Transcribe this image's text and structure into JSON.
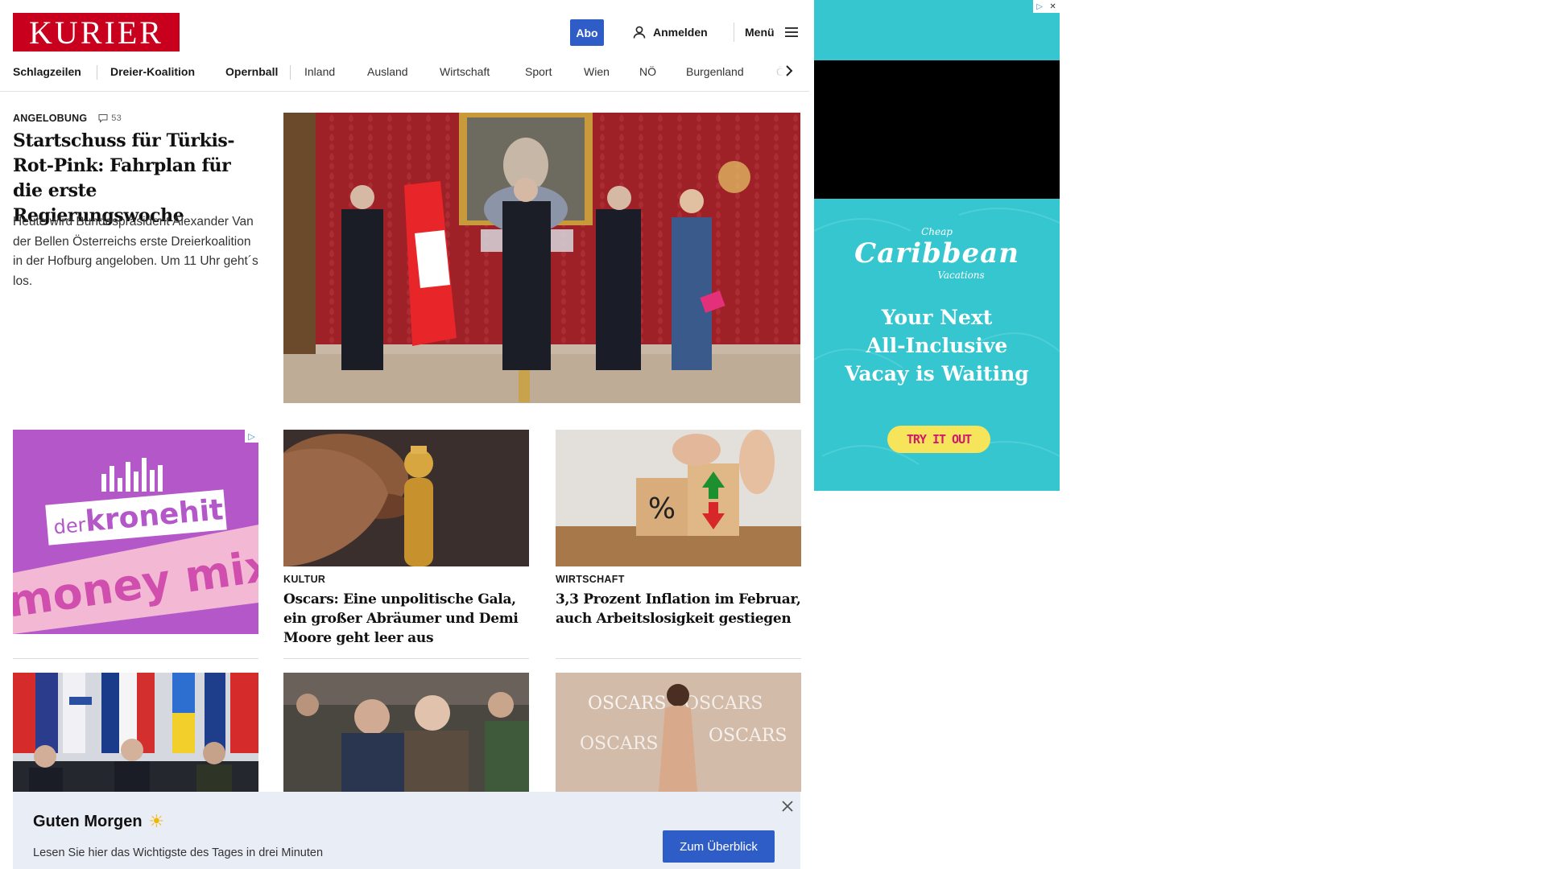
{
  "header": {
    "logo": "KURIER",
    "abo_label": "Abo",
    "login_label": "Anmelden",
    "menu_label": "Menü"
  },
  "nav": {
    "items": [
      "Schlagzeilen",
      "Dreier-Koalition",
      "Opernball",
      "Inland",
      "Ausland",
      "Wirtschaft",
      "Sport",
      "Wien",
      "NÖ",
      "Burgenland",
      "Ö"
    ]
  },
  "lead": {
    "kicker": "ANGELOBUNG",
    "comments": "53",
    "title": "Startschuss für Türkis-Rot-Pink: Fahrplan für die erste Regierungswoche",
    "teaser": "Heute wird Bundespräsident Alexander Van der Bellen Österreichs erste Dreierkoalition in der Hofburg angeloben. Um 11 Uhr geht´s los."
  },
  "ad_left": {
    "brand_prefix": "der",
    "brand": "kronehit",
    "tagline": "money mix"
  },
  "cards": [
    {
      "kicker": "KULTUR",
      "title": "Oscars: Eine unpolitische Gala, ein großer Abräumer und Demi Moore geht leer aus"
    },
    {
      "kicker": "WIRTSCHAFT",
      "title": "3,3 Prozent Inflation im Februar, auch Arbeitslosigkeit gestiegen"
    }
  ],
  "row3_images": [
    "oscars-wall-text"
  ],
  "row3_text": "OSCARS",
  "banner": {
    "title": "Guten Morgen",
    "sun": "☀",
    "subtitle": "Lesen Sie hier das Wichtigste des Tages in drei Minuten",
    "button": "Zum Überblick"
  },
  "ad_right": {
    "brand_top": "Cheap",
    "brand_main": "Caribbean",
    "brand_bottom": "Vacations",
    "headline_1": "Your Next",
    "headline_2": "All-Inclusive",
    "headline_3": "Vacay is Waiting",
    "cta": "TRY IT OUT"
  },
  "colors": {
    "brand_red": "#c8001e",
    "accent_blue": "#2f5dc8",
    "banner_bg": "#e9edf5",
    "ad_teal": "#35c6cf"
  }
}
